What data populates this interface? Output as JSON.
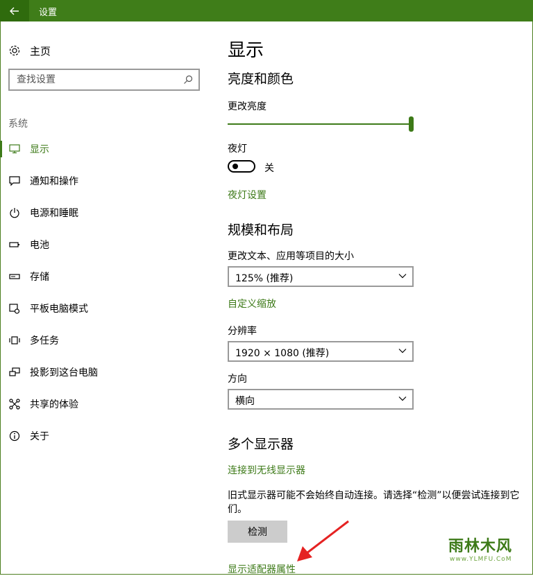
{
  "window": {
    "title": "设置"
  },
  "sidebar": {
    "home_label": "主页",
    "search_placeholder": "查找设置",
    "section_label": "系统",
    "items": [
      {
        "label": "显示",
        "icon": "monitor-icon",
        "active": true
      },
      {
        "label": "通知和操作",
        "icon": "message-icon"
      },
      {
        "label": "电源和睡眠",
        "icon": "power-icon"
      },
      {
        "label": "电池",
        "icon": "battery-icon"
      },
      {
        "label": "存储",
        "icon": "storage-icon"
      },
      {
        "label": "平板电脑模式",
        "icon": "tablet-mode-icon"
      },
      {
        "label": "多任务",
        "icon": "multitask-icon"
      },
      {
        "label": "投影到这台电脑",
        "icon": "project-icon"
      },
      {
        "label": "共享的体验",
        "icon": "share-icon"
      },
      {
        "label": "关于",
        "icon": "info-icon"
      }
    ]
  },
  "main": {
    "title": "显示",
    "brightness_heading": "亮度和颜色",
    "brightness_label": "更改亮度",
    "brightness_level": 1.0,
    "night_light_label": "夜灯",
    "night_light_state": "关",
    "night_light_settings_link": "夜灯设置",
    "scale_heading": "规模和布局",
    "scale_label": "更改文本、应用等项目的大小",
    "scale_value": "125% (推荐)",
    "custom_scale_link": "自定义缩放",
    "resolution_label": "分辨率",
    "resolution_value": "1920 × 1080 (推荐)",
    "orientation_label": "方向",
    "orientation_value": "横向",
    "multi_heading": "多个显示器",
    "wireless_link": "连接到无线显示器",
    "old_display_text": "旧式显示器可能不会始终自动连接。请选择“检测”以便尝试连接到它们。",
    "detect_button": "检测",
    "adapter_link": "显示适配器属性"
  },
  "colors": {
    "accent": "#3d7a18",
    "titlebar": "#3f7d19"
  },
  "watermark": {
    "text": "雨林木风",
    "url": "www.YLMFU.CoM"
  }
}
